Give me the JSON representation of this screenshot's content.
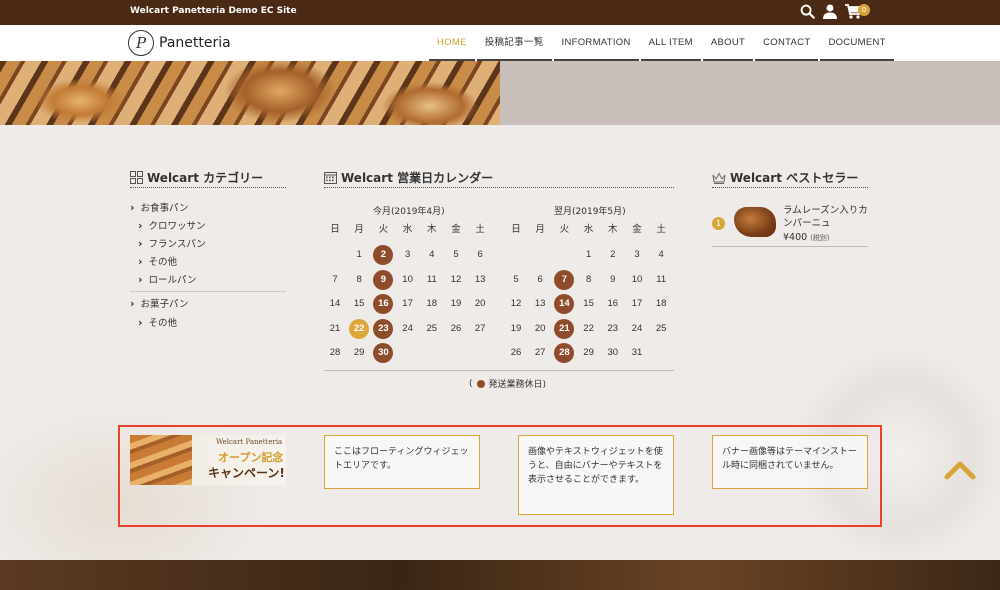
{
  "topbar": {
    "site_name": "Welcart Panetteria Demo EC Site",
    "cart_count": "0"
  },
  "nav": {
    "logo_mark": "P",
    "logo_text": "Panetteria",
    "items": [
      "HOME",
      "投稿記事一覧",
      "INFORMATION",
      "ALL ITEM",
      "ABOUT",
      "CONTACT",
      "DOCUMENT"
    ]
  },
  "colors": {
    "topbar": "#4a2a14",
    "accent": "#d9a43a",
    "holiday": "#8f4c2c",
    "highlight_border": "#e8412c"
  },
  "category_widget": {
    "title": "Welcart カテゴリー",
    "groups": [
      {
        "label": "お食事パン",
        "children": [
          "クロワッサン",
          "フランスパン",
          "その他",
          "ロールパン"
        ]
      },
      {
        "label": "お菓子パン",
        "children": [
          "その他"
        ]
      }
    ]
  },
  "calendar_widget": {
    "title": "Welcart 営業日カレンダー",
    "weekdays": [
      "日",
      "月",
      "火",
      "水",
      "木",
      "金",
      "土"
    ],
    "months": [
      {
        "label": "今月(2019年4月)",
        "weeks": [
          [
            "",
            "1",
            "2",
            "3",
            "4",
            "5",
            "6"
          ],
          [
            "7",
            "8",
            "9",
            "10",
            "11",
            "12",
            "13"
          ],
          [
            "14",
            "15",
            "16",
            "17",
            "18",
            "19",
            "20"
          ],
          [
            "21",
            "22",
            "23",
            "24",
            "25",
            "26",
            "27"
          ],
          [
            "28",
            "29",
            "30",
            "",
            "",
            "",
            ""
          ]
        ],
        "holidays": [
          "2",
          "9",
          "16",
          "23",
          "30"
        ],
        "today": "22"
      },
      {
        "label": "翌月(2019年5月)",
        "weeks": [
          [
            "",
            "",
            "",
            "1",
            "2",
            "3",
            "4"
          ],
          [
            "5",
            "6",
            "7",
            "8",
            "9",
            "10",
            "11"
          ],
          [
            "12",
            "13",
            "14",
            "15",
            "16",
            "17",
            "18"
          ],
          [
            "19",
            "20",
            "21",
            "22",
            "23",
            "24",
            "25"
          ],
          [
            "26",
            "27",
            "28",
            "29",
            "30",
            "31",
            ""
          ]
        ],
        "holidays": [
          "7",
          "14",
          "21",
          "28"
        ],
        "today": ""
      }
    ],
    "legend_open": "(",
    "legend_text": "発送業務休日)"
  },
  "bestseller_widget": {
    "title": "Welcart ベストセラー",
    "items": [
      {
        "rank": "1",
        "name": "ラムレーズン入りカンパーニュ",
        "price": "¥400",
        "tax": "(税別)"
      }
    ]
  },
  "floating_widgets": {
    "banner": {
      "subtitle": "Welcart Panetteria",
      "line1": "オープン記念",
      "line2": "キャンペーン!!"
    },
    "texts": [
      "ここはフローティングウィジェットエリアです。",
      "画像やテキストウィジェットを使うと、自由にバナーやテキストを表示させることができます。",
      "バナー画像等はテーマインストール時に同梱されていません。"
    ]
  },
  "icons": {
    "search": "search-icon",
    "user": "user-icon",
    "cart": "cart-icon",
    "category": "grid-icon",
    "calendar": "calendar-icon",
    "bestseller": "crown-icon",
    "back_to_top": "chevron-up-icon"
  }
}
